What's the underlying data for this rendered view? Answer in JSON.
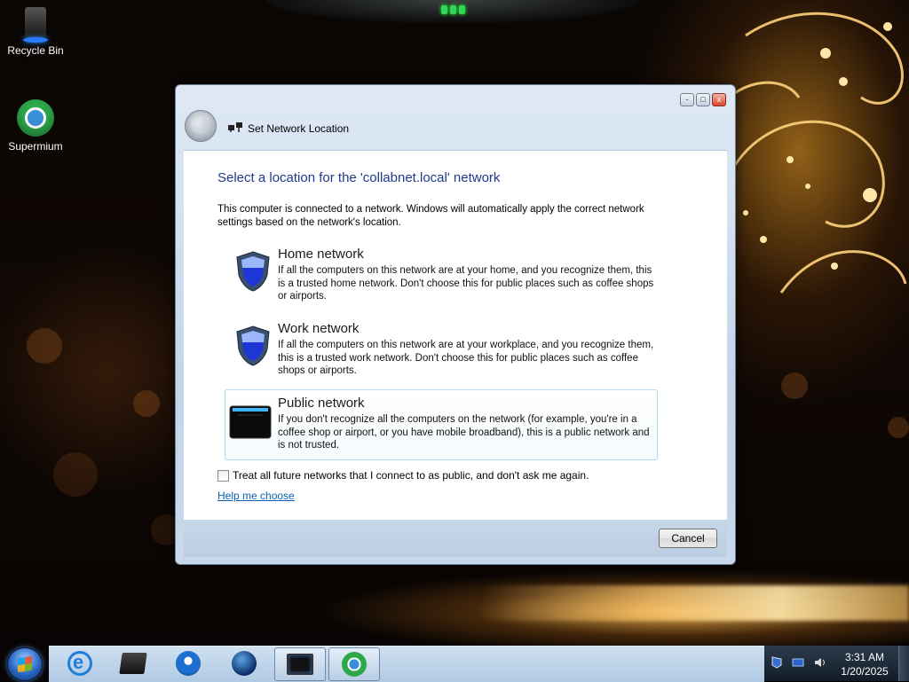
{
  "desktop": {
    "icons": [
      {
        "label": "Recycle Bin",
        "icon": "recycle-bin-icon"
      },
      {
        "label": "Supermium",
        "icon": "supermium-browser-icon"
      }
    ]
  },
  "dialog": {
    "title": "Set Network Location",
    "heading": "Select a location for the 'collabnet.local' network",
    "intro": "This computer is connected to a network. Windows will automatically apply the correct network settings based on the network's location.",
    "options": [
      {
        "title": "Home network",
        "description": "If all the computers on this network are at your home, and you recognize them, this is a trusted home network.  Don't choose this for public places such as coffee shops or airports.",
        "icon": "shield-icon"
      },
      {
        "title": "Work network",
        "description": "If all the computers on this network are at your workplace, and you recognize them, this is a trusted work network.  Don't choose this for public places such as coffee shops or airports.",
        "icon": "shield-icon"
      },
      {
        "title": "Public network",
        "description": "If you don't recognize all the computers on the network (for example, you're in a coffee shop or airport, or you have mobile broadband), this is a public network and is not trusted.",
        "icon": "public-bench-icon"
      }
    ],
    "checkbox_label": "Treat all future networks that I connect to as public, and don't ask me again.",
    "checkbox_checked": false,
    "help_link": "Help me choose",
    "cancel_label": "Cancel",
    "window_buttons": {
      "minimize": "-",
      "maximize": "□",
      "close": "x"
    }
  },
  "taskbar": {
    "items": [
      {
        "name": "internet-explorer",
        "icon": "ie-icon"
      },
      {
        "name": "drive",
        "icon": "drive-icon"
      },
      {
        "name": "media-player",
        "icon": "media-player-icon"
      },
      {
        "name": "network-globe",
        "icon": "globe-icon"
      },
      {
        "name": "network-window",
        "icon": "monitor-icon"
      },
      {
        "name": "supermium",
        "icon": "chrome-icon"
      }
    ],
    "clock": {
      "time": "3:31 AM",
      "date": "1/20/2025"
    }
  },
  "colors": {
    "heading": "#1e3a8a",
    "link": "#0b60b6",
    "option_hover_border": "#b2dbed"
  }
}
